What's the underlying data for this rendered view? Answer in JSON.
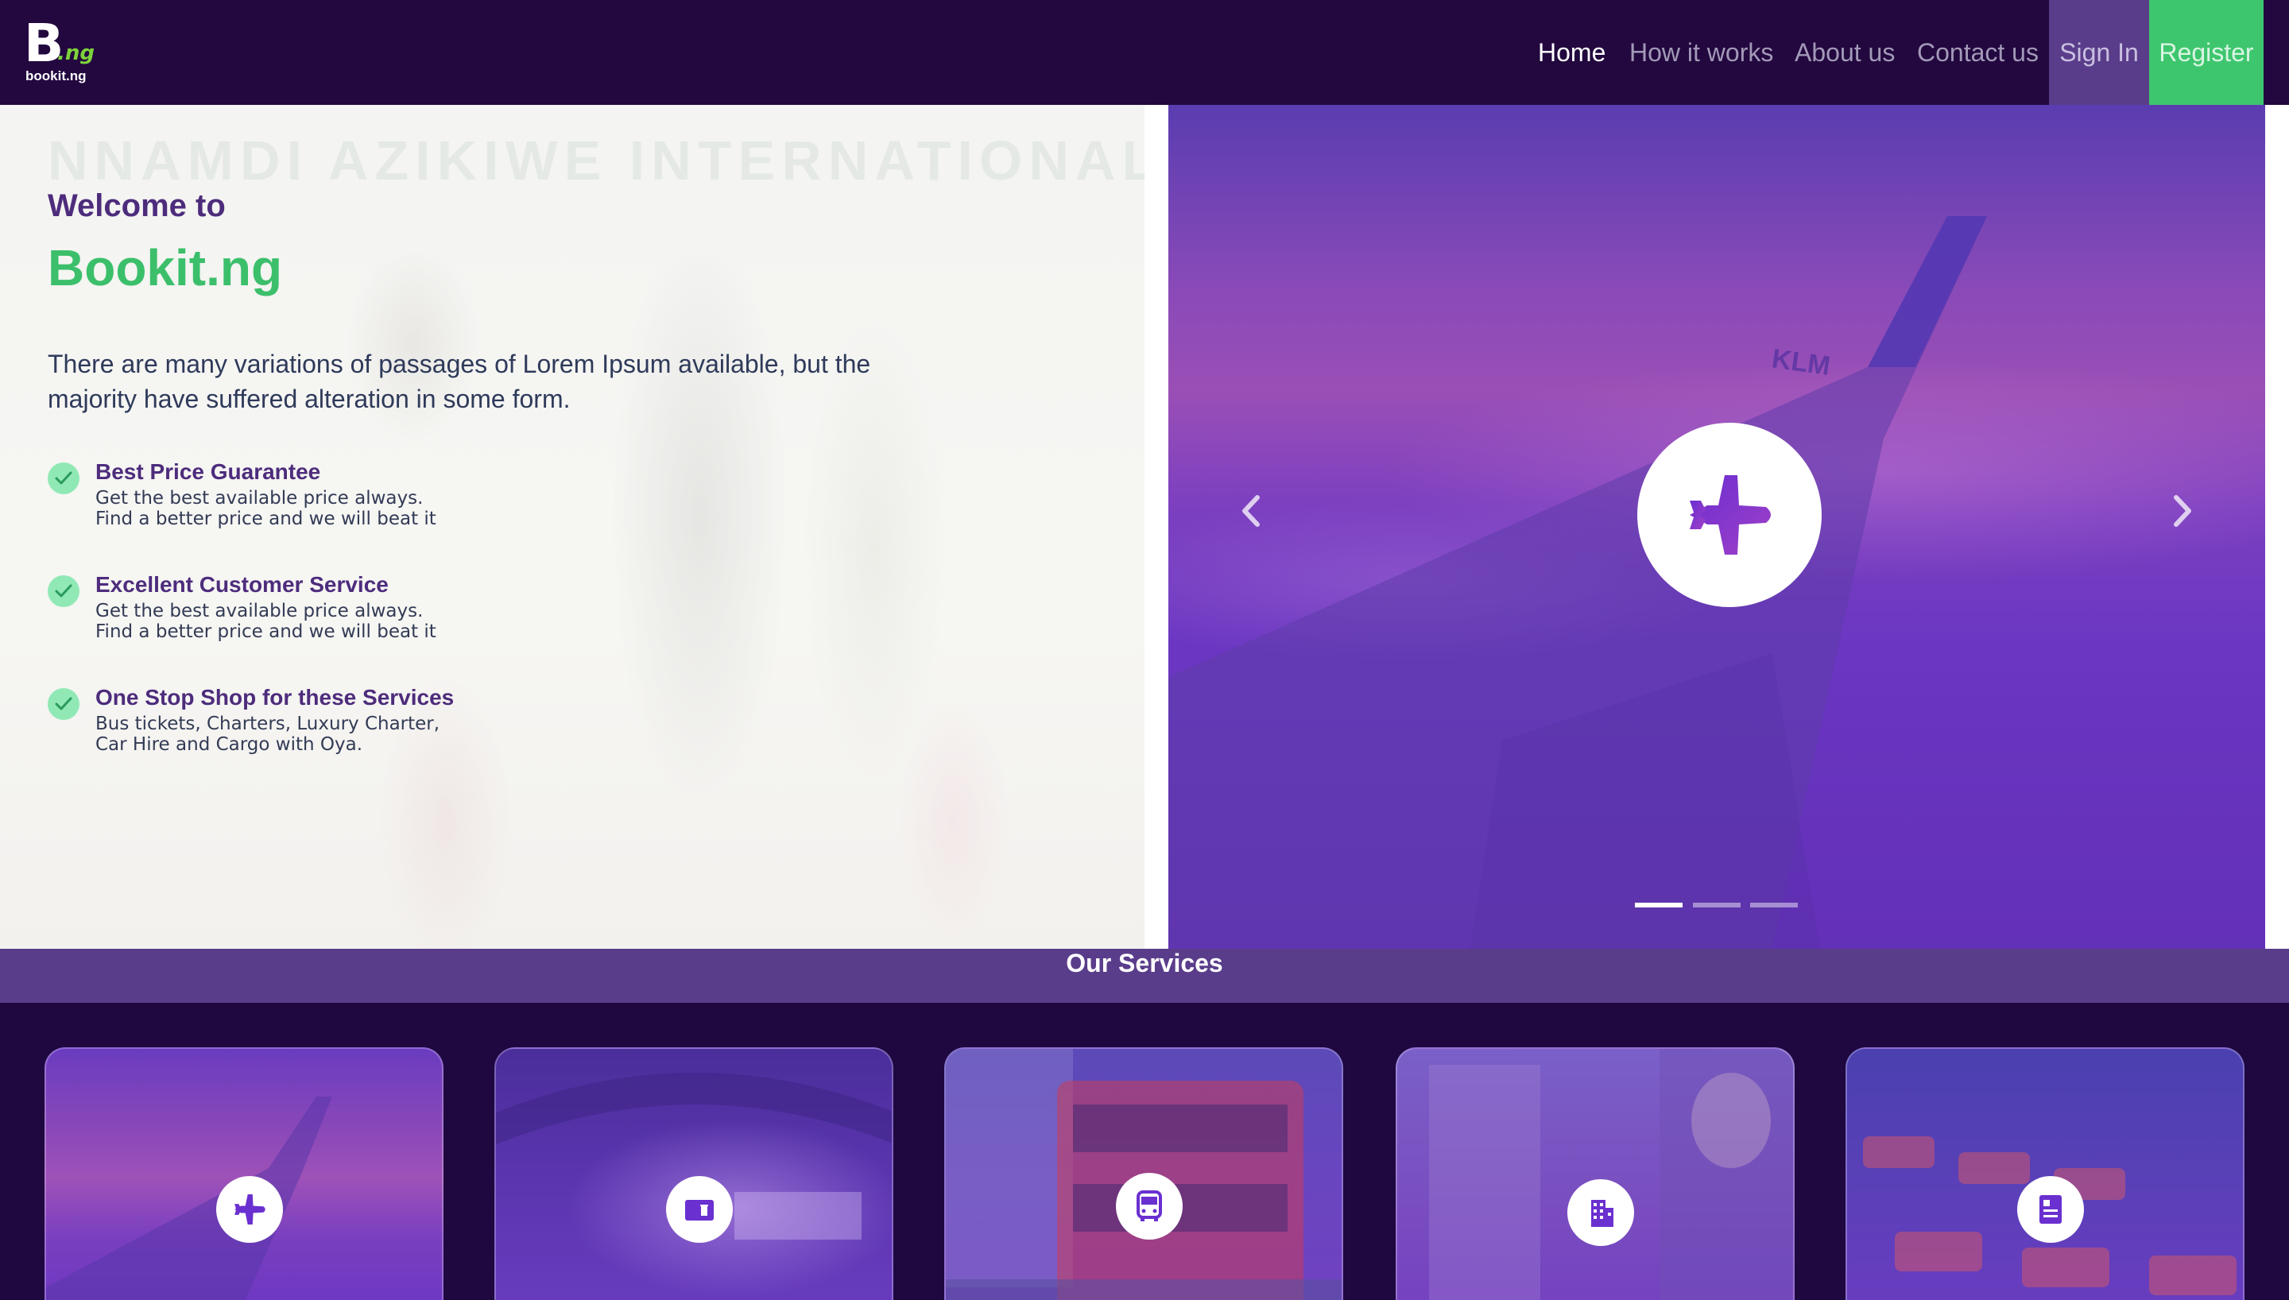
{
  "brand": {
    "logo_letter": "B",
    "logo_suffix": ".ng",
    "logo_sub": "bookit.ng"
  },
  "nav": {
    "items": [
      {
        "label": "Home",
        "active": true
      },
      {
        "label": "How it works",
        "active": false
      },
      {
        "label": "About us",
        "active": false
      },
      {
        "label": "Contact us",
        "active": false
      }
    ],
    "sign_in": "Sign In",
    "register": "Register"
  },
  "hero": {
    "background_sign": "NNAMDI AZIKIWE INTERNATIONAL AIR",
    "welcome": "Welcome to",
    "brand_name": "Bookit.ng",
    "intro": "There are many variations of passages of Lorem Ipsum available, but the majority have suffered alteration in some form.",
    "features": [
      {
        "title": "Best Price Guarantee",
        "line1": "Get the best available price always.",
        "line2": "Find a better price and we will beat it",
        "icon": "check-icon"
      },
      {
        "title": "Excellent Customer Service",
        "line1": "Get the best available price always.",
        "line2": "Find a better price and we will beat it",
        "icon": "check-icon"
      },
      {
        "title": "One Stop Shop for these Services",
        "line1": "Bus tickets, Charters, Luxury Charter,",
        "line2": "Car Hire and Cargo with Oya.",
        "icon": "check-icon"
      }
    ]
  },
  "carousel": {
    "wing_text": "KLM",
    "center_icon": "airplane-icon",
    "prev_icon": "chevron-left-icon",
    "next_icon": "chevron-right-icon",
    "slide_count": 3,
    "active_slide": 1
  },
  "services": {
    "title": "Our Services",
    "cards": [
      {
        "icon": "airplane-icon",
        "theme": "flights"
      },
      {
        "icon": "cinema-ticket-icon",
        "theme": "events"
      },
      {
        "icon": "bus-icon",
        "theme": "bus"
      },
      {
        "icon": "hotel-icon",
        "theme": "hotels"
      },
      {
        "icon": "id-card-icon",
        "theme": "conference"
      }
    ]
  },
  "colors": {
    "navbar": "#22083f",
    "purple_accent": "#5a3d8a",
    "green_accent": "#3ec66e",
    "heading_purple": "#4d2c7c",
    "brand_green": "#3cbf6b",
    "icon_purple": "#6a30d0"
  }
}
